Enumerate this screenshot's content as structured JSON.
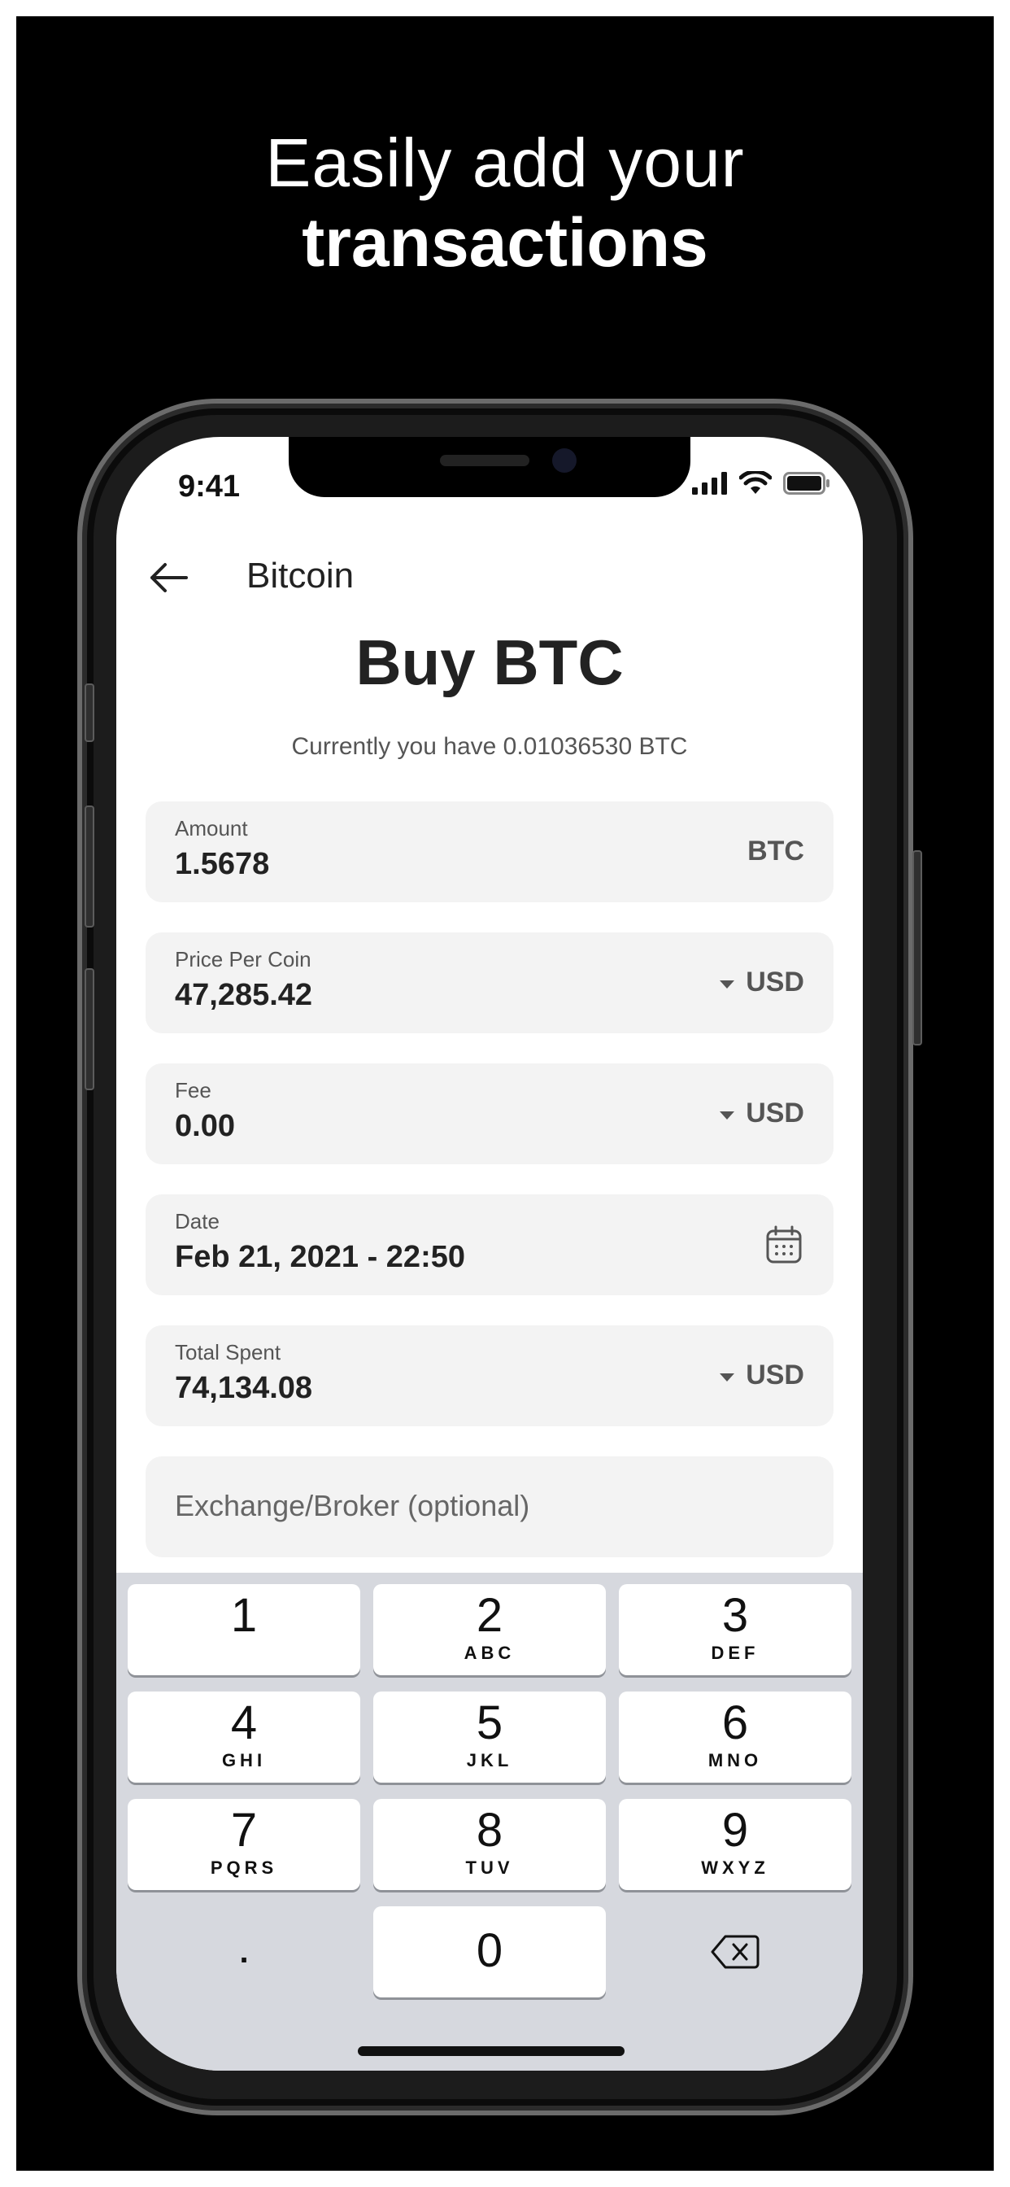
{
  "headline": {
    "line1": "Easily add your",
    "line2": "transactions"
  },
  "status_bar": {
    "time": "9:41",
    "icons": [
      "signal-icon",
      "wifi-icon",
      "battery-icon"
    ]
  },
  "nav": {
    "back_icon": "arrow-left-icon",
    "title": "Bitcoin"
  },
  "page": {
    "title": "Buy BTC",
    "subtitle": "Currently you have 0.01036530 BTC"
  },
  "fields": {
    "amount": {
      "label": "Amount",
      "value": "1.5678",
      "unit": "BTC"
    },
    "price_per_coin": {
      "label": "Price Per Coin",
      "value": "47,285.42",
      "currency": "USD"
    },
    "fee": {
      "label": "Fee",
      "value": "0.00",
      "currency": "USD"
    },
    "date": {
      "label": "Date",
      "value": "Feb 21, 2021 - 22:50",
      "icon": "calendar-icon"
    },
    "total_spent": {
      "label": "Total Spent",
      "value": "74,134.08",
      "currency": "USD"
    },
    "exchange": {
      "placeholder": "Exchange/Broker (optional)"
    }
  },
  "keypad": {
    "keys": [
      {
        "digit": "1",
        "letters": ""
      },
      {
        "digit": "2",
        "letters": "ABC"
      },
      {
        "digit": "3",
        "letters": "DEF"
      },
      {
        "digit": "4",
        "letters": "GHI"
      },
      {
        "digit": "5",
        "letters": "JKL"
      },
      {
        "digit": "6",
        "letters": "MNO"
      },
      {
        "digit": "7",
        "letters": "PQRS"
      },
      {
        "digit": "8",
        "letters": "TUV"
      },
      {
        "digit": "9",
        "letters": "WXYZ"
      },
      {
        "digit": "0",
        "letters": ""
      }
    ],
    "decimal": ".",
    "delete_icon": "backspace-icon"
  },
  "colors": {
    "background": "#000000",
    "field_bg": "#f3f3f3",
    "keyboard_bg": "#d6d8de",
    "text": "#222222"
  }
}
